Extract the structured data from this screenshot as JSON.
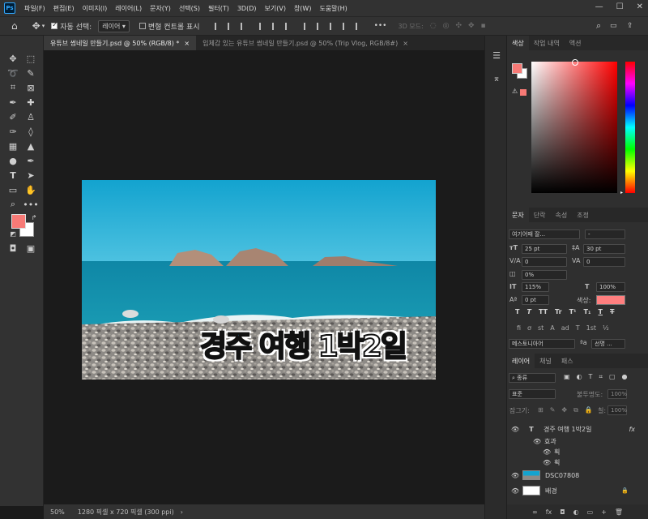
{
  "app": {
    "logo": "Ps"
  },
  "menu": [
    "파일(F)",
    "편집(E)",
    "이미지(I)",
    "레이어(L)",
    "문자(Y)",
    "선택(S)",
    "필터(T)",
    "3D(D)",
    "보기(V)",
    "창(W)",
    "도움말(H)"
  ],
  "window_controls": {
    "minimize": "—",
    "maximize": "☐",
    "close": "✕"
  },
  "options": {
    "auto_select_label": "자동 선택:",
    "auto_select_value": "레이어",
    "transform_label": "변형 컨트롤 표시",
    "more": "•••",
    "mode3d_label": "3D 모드:"
  },
  "tabs": [
    {
      "label": "유튜브 썸네일 만들기.psd @ 50% (RGB/8) *",
      "close": "×"
    },
    {
      "label": "입체감 있는 유튜브 썸네일 만들기.psd @ 50% (Trip Vlog, RGB/8#)",
      "close": "×"
    }
  ],
  "image": {
    "text": "경주 여행 1박2일",
    "text_part1": "경주",
    "text_part2": "여행 1박2일"
  },
  "status": {
    "zoom": "50%",
    "doc_info": "1280 픽셀 x 720 픽셀 (300 ppi)",
    "arrow": "›"
  },
  "color_panel": {
    "tabs": [
      "색상",
      "작업 내역",
      "액션"
    ],
    "fg_color": "#f77a76"
  },
  "char_panel": {
    "tabs": [
      "문자",
      "단락",
      "속성",
      "조정"
    ],
    "font_family": "여기어때 잘...",
    "font_style": "-",
    "font_size": "25 pt",
    "leading": "30 pt",
    "kerning": "0",
    "tracking": "0",
    "scale_pct": "0%",
    "vscale": "115%",
    "hscale": "100%",
    "baseline": "0 pt",
    "color_label": "색상:",
    "text_color": "#ff7f7f",
    "style_buttons": [
      "T",
      "T",
      "TT",
      "Tr",
      "T¹",
      "T₁",
      "T",
      "T"
    ],
    "ot_buttons": [
      "fi",
      "ơ",
      "st",
      "A",
      "ad",
      "T",
      "1st",
      "½"
    ],
    "language": "메스토니아어",
    "aa_icon": "ªa",
    "aa_value": "선명 ..."
  },
  "layers_panel": {
    "tabs": [
      "레이어",
      "채널",
      "패스"
    ],
    "filter_label": "종류",
    "blend_mode": "표준",
    "opacity_label": "불투명도:",
    "opacity": "100%",
    "lock_label": "잠그기:",
    "fill_label": "칠:",
    "fill": "100%",
    "layers": [
      {
        "name": "경주 여행 1박2일",
        "kind": "T",
        "fx": "fx"
      },
      {
        "name": "효과",
        "kind": "effects"
      },
      {
        "name": "획",
        "kind": "effect"
      },
      {
        "name": "획",
        "kind": "effect"
      },
      {
        "name": "DSC07808",
        "kind": "image"
      },
      {
        "name": "배경",
        "kind": "background"
      }
    ],
    "footer_icons": [
      "∞",
      "fx",
      "◘",
      "◐",
      "▭",
      "+",
      "🗑"
    ]
  }
}
